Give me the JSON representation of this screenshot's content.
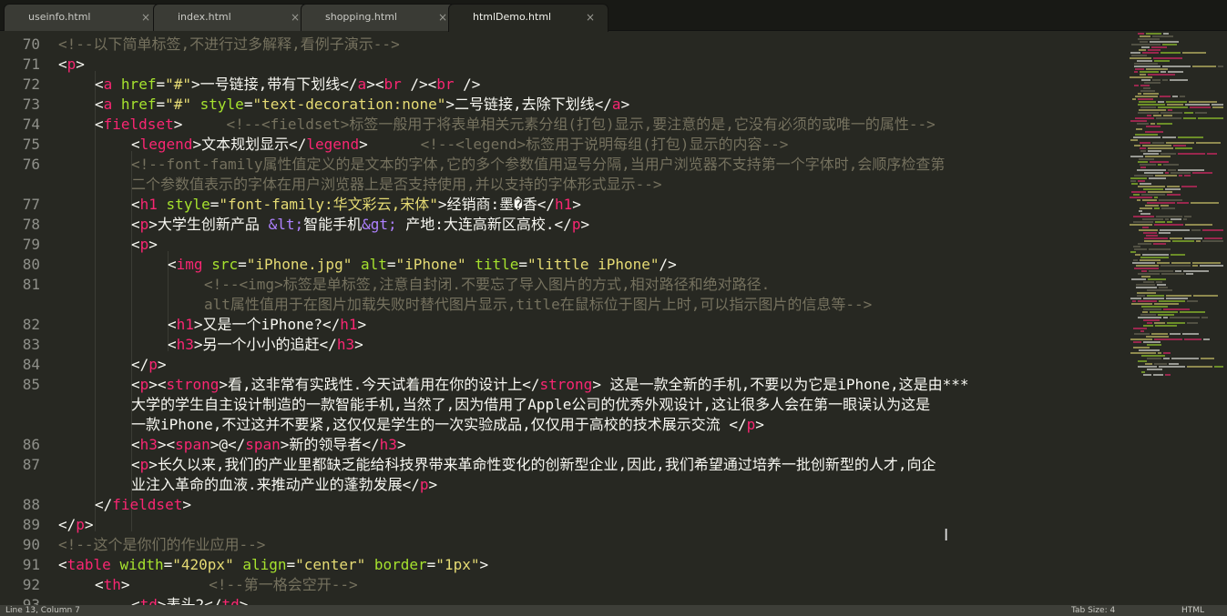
{
  "tabs": [
    {
      "label": "useinfo.html",
      "close": "×",
      "active": false
    },
    {
      "label": "index.html",
      "close": "×",
      "active": false
    },
    {
      "label": "shopping.html",
      "close": "×",
      "active": false
    },
    {
      "label": "htmlDemo.html",
      "close": "×",
      "active": true
    }
  ],
  "line_numbers": [
    "70",
    "71",
    "72",
    "73",
    "74",
    "75",
    "76",
    "",
    "77",
    "78",
    "79",
    "80",
    "81",
    "",
    "82",
    "83",
    "84",
    "85",
    "",
    "",
    "86",
    "87",
    "",
    "88",
    "89",
    "90",
    "91",
    "92",
    "93"
  ],
  "status": {
    "position": "Line 13, Column 7",
    "tab_size": "Tab Size: 4",
    "syntax": "HTML"
  },
  "colors": {
    "background": "#272822",
    "tag": "#f92672",
    "attribute": "#a6e22e",
    "string": "#e6db74",
    "comment": "#75715e",
    "entity": "#ae81ff"
  }
}
